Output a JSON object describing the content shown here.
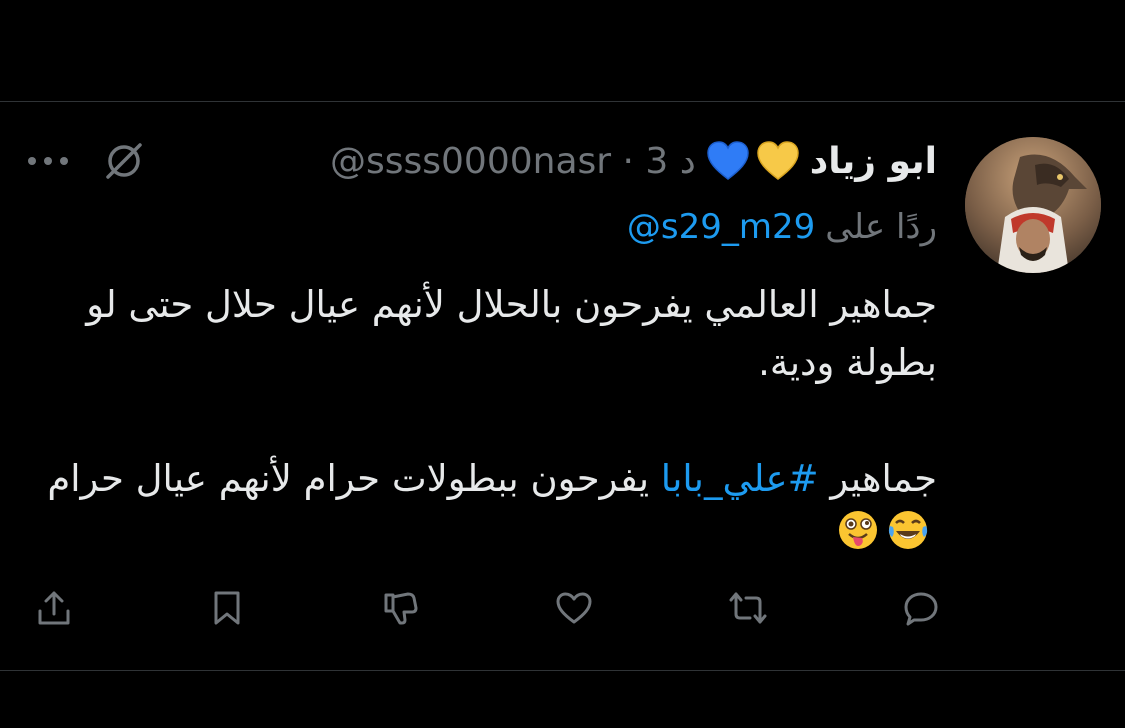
{
  "tweet": {
    "author_name": "ابو زياد",
    "hearts": [
      "yellow-heart",
      "blue-heart"
    ],
    "meta": "@ssss0000nasr · 3 د",
    "reply_label": "ردًا على",
    "reply_handle": "@s29_m29",
    "body": {
      "line1": "جماهير العالمي يفرحون بالحلال لأنهم عيال حلال حتى لو بطولة ودية.",
      "line2_before": "جماهير ",
      "hashtag": "#علي_بابا",
      "line2_after": " يفرحون ببطولات حرام لأنهم عيال حرام",
      "emojis": [
        "laughing-tears-emoji",
        "winking-tongue-emoji"
      ]
    }
  },
  "icons": {
    "header": [
      "grok-icon",
      "more-icon"
    ],
    "actions": [
      "reply-icon",
      "retweet-icon",
      "like-icon",
      "dislike-icon",
      "bookmark-icon",
      "share-icon"
    ]
  },
  "colors": {
    "background": "#000000",
    "text": "#e7e9ea",
    "muted": "#71767b",
    "link": "#1d9bf0",
    "divider": "#2f3336"
  }
}
